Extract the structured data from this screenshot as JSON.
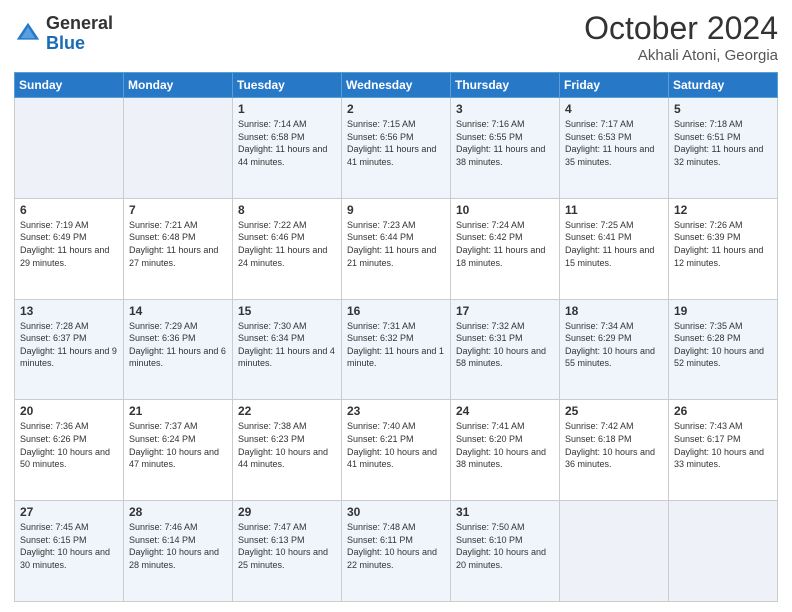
{
  "logo": {
    "general": "General",
    "blue": "Blue"
  },
  "header": {
    "month": "October 2024",
    "location": "Akhali Atoni, Georgia"
  },
  "weekdays": [
    "Sunday",
    "Monday",
    "Tuesday",
    "Wednesday",
    "Thursday",
    "Friday",
    "Saturday"
  ],
  "weeks": [
    [
      {
        "day": "",
        "sunrise": "",
        "sunset": "",
        "daylight": ""
      },
      {
        "day": "",
        "sunrise": "",
        "sunset": "",
        "daylight": ""
      },
      {
        "day": "1",
        "sunrise": "Sunrise: 7:14 AM",
        "sunset": "Sunset: 6:58 PM",
        "daylight": "Daylight: 11 hours and 44 minutes."
      },
      {
        "day": "2",
        "sunrise": "Sunrise: 7:15 AM",
        "sunset": "Sunset: 6:56 PM",
        "daylight": "Daylight: 11 hours and 41 minutes."
      },
      {
        "day": "3",
        "sunrise": "Sunrise: 7:16 AM",
        "sunset": "Sunset: 6:55 PM",
        "daylight": "Daylight: 11 hours and 38 minutes."
      },
      {
        "day": "4",
        "sunrise": "Sunrise: 7:17 AM",
        "sunset": "Sunset: 6:53 PM",
        "daylight": "Daylight: 11 hours and 35 minutes."
      },
      {
        "day": "5",
        "sunrise": "Sunrise: 7:18 AM",
        "sunset": "Sunset: 6:51 PM",
        "daylight": "Daylight: 11 hours and 32 minutes."
      }
    ],
    [
      {
        "day": "6",
        "sunrise": "Sunrise: 7:19 AM",
        "sunset": "Sunset: 6:49 PM",
        "daylight": "Daylight: 11 hours and 29 minutes."
      },
      {
        "day": "7",
        "sunrise": "Sunrise: 7:21 AM",
        "sunset": "Sunset: 6:48 PM",
        "daylight": "Daylight: 11 hours and 27 minutes."
      },
      {
        "day": "8",
        "sunrise": "Sunrise: 7:22 AM",
        "sunset": "Sunset: 6:46 PM",
        "daylight": "Daylight: 11 hours and 24 minutes."
      },
      {
        "day": "9",
        "sunrise": "Sunrise: 7:23 AM",
        "sunset": "Sunset: 6:44 PM",
        "daylight": "Daylight: 11 hours and 21 minutes."
      },
      {
        "day": "10",
        "sunrise": "Sunrise: 7:24 AM",
        "sunset": "Sunset: 6:42 PM",
        "daylight": "Daylight: 11 hours and 18 minutes."
      },
      {
        "day": "11",
        "sunrise": "Sunrise: 7:25 AM",
        "sunset": "Sunset: 6:41 PM",
        "daylight": "Daylight: 11 hours and 15 minutes."
      },
      {
        "day": "12",
        "sunrise": "Sunrise: 7:26 AM",
        "sunset": "Sunset: 6:39 PM",
        "daylight": "Daylight: 11 hours and 12 minutes."
      }
    ],
    [
      {
        "day": "13",
        "sunrise": "Sunrise: 7:28 AM",
        "sunset": "Sunset: 6:37 PM",
        "daylight": "Daylight: 11 hours and 9 minutes."
      },
      {
        "day": "14",
        "sunrise": "Sunrise: 7:29 AM",
        "sunset": "Sunset: 6:36 PM",
        "daylight": "Daylight: 11 hours and 6 minutes."
      },
      {
        "day": "15",
        "sunrise": "Sunrise: 7:30 AM",
        "sunset": "Sunset: 6:34 PM",
        "daylight": "Daylight: 11 hours and 4 minutes."
      },
      {
        "day": "16",
        "sunrise": "Sunrise: 7:31 AM",
        "sunset": "Sunset: 6:32 PM",
        "daylight": "Daylight: 11 hours and 1 minute."
      },
      {
        "day": "17",
        "sunrise": "Sunrise: 7:32 AM",
        "sunset": "Sunset: 6:31 PM",
        "daylight": "Daylight: 10 hours and 58 minutes."
      },
      {
        "day": "18",
        "sunrise": "Sunrise: 7:34 AM",
        "sunset": "Sunset: 6:29 PM",
        "daylight": "Daylight: 10 hours and 55 minutes."
      },
      {
        "day": "19",
        "sunrise": "Sunrise: 7:35 AM",
        "sunset": "Sunset: 6:28 PM",
        "daylight": "Daylight: 10 hours and 52 minutes."
      }
    ],
    [
      {
        "day": "20",
        "sunrise": "Sunrise: 7:36 AM",
        "sunset": "Sunset: 6:26 PM",
        "daylight": "Daylight: 10 hours and 50 minutes."
      },
      {
        "day": "21",
        "sunrise": "Sunrise: 7:37 AM",
        "sunset": "Sunset: 6:24 PM",
        "daylight": "Daylight: 10 hours and 47 minutes."
      },
      {
        "day": "22",
        "sunrise": "Sunrise: 7:38 AM",
        "sunset": "Sunset: 6:23 PM",
        "daylight": "Daylight: 10 hours and 44 minutes."
      },
      {
        "day": "23",
        "sunrise": "Sunrise: 7:40 AM",
        "sunset": "Sunset: 6:21 PM",
        "daylight": "Daylight: 10 hours and 41 minutes."
      },
      {
        "day": "24",
        "sunrise": "Sunrise: 7:41 AM",
        "sunset": "Sunset: 6:20 PM",
        "daylight": "Daylight: 10 hours and 38 minutes."
      },
      {
        "day": "25",
        "sunrise": "Sunrise: 7:42 AM",
        "sunset": "Sunset: 6:18 PM",
        "daylight": "Daylight: 10 hours and 36 minutes."
      },
      {
        "day": "26",
        "sunrise": "Sunrise: 7:43 AM",
        "sunset": "Sunset: 6:17 PM",
        "daylight": "Daylight: 10 hours and 33 minutes."
      }
    ],
    [
      {
        "day": "27",
        "sunrise": "Sunrise: 7:45 AM",
        "sunset": "Sunset: 6:15 PM",
        "daylight": "Daylight: 10 hours and 30 minutes."
      },
      {
        "day": "28",
        "sunrise": "Sunrise: 7:46 AM",
        "sunset": "Sunset: 6:14 PM",
        "daylight": "Daylight: 10 hours and 28 minutes."
      },
      {
        "day": "29",
        "sunrise": "Sunrise: 7:47 AM",
        "sunset": "Sunset: 6:13 PM",
        "daylight": "Daylight: 10 hours and 25 minutes."
      },
      {
        "day": "30",
        "sunrise": "Sunrise: 7:48 AM",
        "sunset": "Sunset: 6:11 PM",
        "daylight": "Daylight: 10 hours and 22 minutes."
      },
      {
        "day": "31",
        "sunrise": "Sunrise: 7:50 AM",
        "sunset": "Sunset: 6:10 PM",
        "daylight": "Daylight: 10 hours and 20 minutes."
      },
      {
        "day": "",
        "sunrise": "",
        "sunset": "",
        "daylight": ""
      },
      {
        "day": "",
        "sunrise": "",
        "sunset": "",
        "daylight": ""
      }
    ]
  ]
}
